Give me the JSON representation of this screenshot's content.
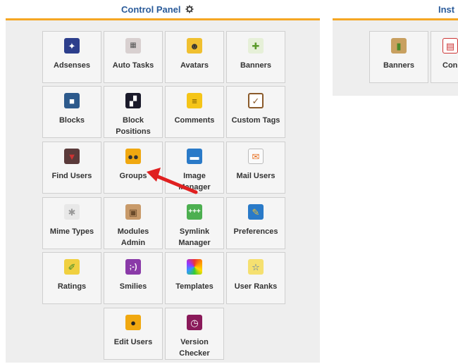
{
  "control_panel": {
    "title": "Control Panel",
    "tiles": [
      {
        "label": "Adsenses"
      },
      {
        "label": "Auto Tasks"
      },
      {
        "label": "Avatars"
      },
      {
        "label": "Banners"
      },
      {
        "label": "Blocks"
      },
      {
        "label": "Block Positions"
      },
      {
        "label": "Comments"
      },
      {
        "label": "Custom Tags"
      },
      {
        "label": "Find Users"
      },
      {
        "label": "Groups"
      },
      {
        "label": "Image Manager"
      },
      {
        "label": "Mail Users"
      },
      {
        "label": "Mime Types"
      },
      {
        "label": "Modules Admin"
      },
      {
        "label": "Symlink Manager"
      },
      {
        "label": "Preferences"
      },
      {
        "label": "Ratings"
      },
      {
        "label": "Smilies"
      },
      {
        "label": "Templates"
      },
      {
        "label": "User Ranks"
      },
      {
        "label": "Edit Users"
      },
      {
        "label": "Version Checker"
      }
    ]
  },
  "installed_modules": {
    "title": "Inst",
    "tiles": [
      {
        "label": "Banners"
      },
      {
        "label": "Con"
      }
    ]
  },
  "icons": {
    "adsenses": "magic-wand-icon",
    "auto_tasks": "calculator-icon",
    "avatars": "face-icon",
    "banners": "puzzle-icon",
    "blocks": "cubes-icon",
    "block_positions": "grid-icon",
    "comments": "note-icon",
    "custom_tags": "clipboard-icon",
    "find_users": "suit-icon",
    "groups": "group-icon",
    "image_manager": "picture-icon",
    "mail_users": "envelope-icon",
    "mime_types": "gear-icon",
    "modules_admin": "box-icon",
    "symlink_manager": "link-icon",
    "preferences": "wrench-icon",
    "ratings": "pen-icon",
    "smilies": "smiley-icon",
    "templates": "palette-icon",
    "user_ranks": "star-icon",
    "edit_users": "user-icon",
    "version_checker": "clock-icon"
  },
  "colors": {
    "title": "#2a5b9a",
    "accent_bar": "#f5a623",
    "panel_bg": "#eeeeee",
    "tile_bg": "#f5f5f5",
    "arrow": "#e02020"
  }
}
